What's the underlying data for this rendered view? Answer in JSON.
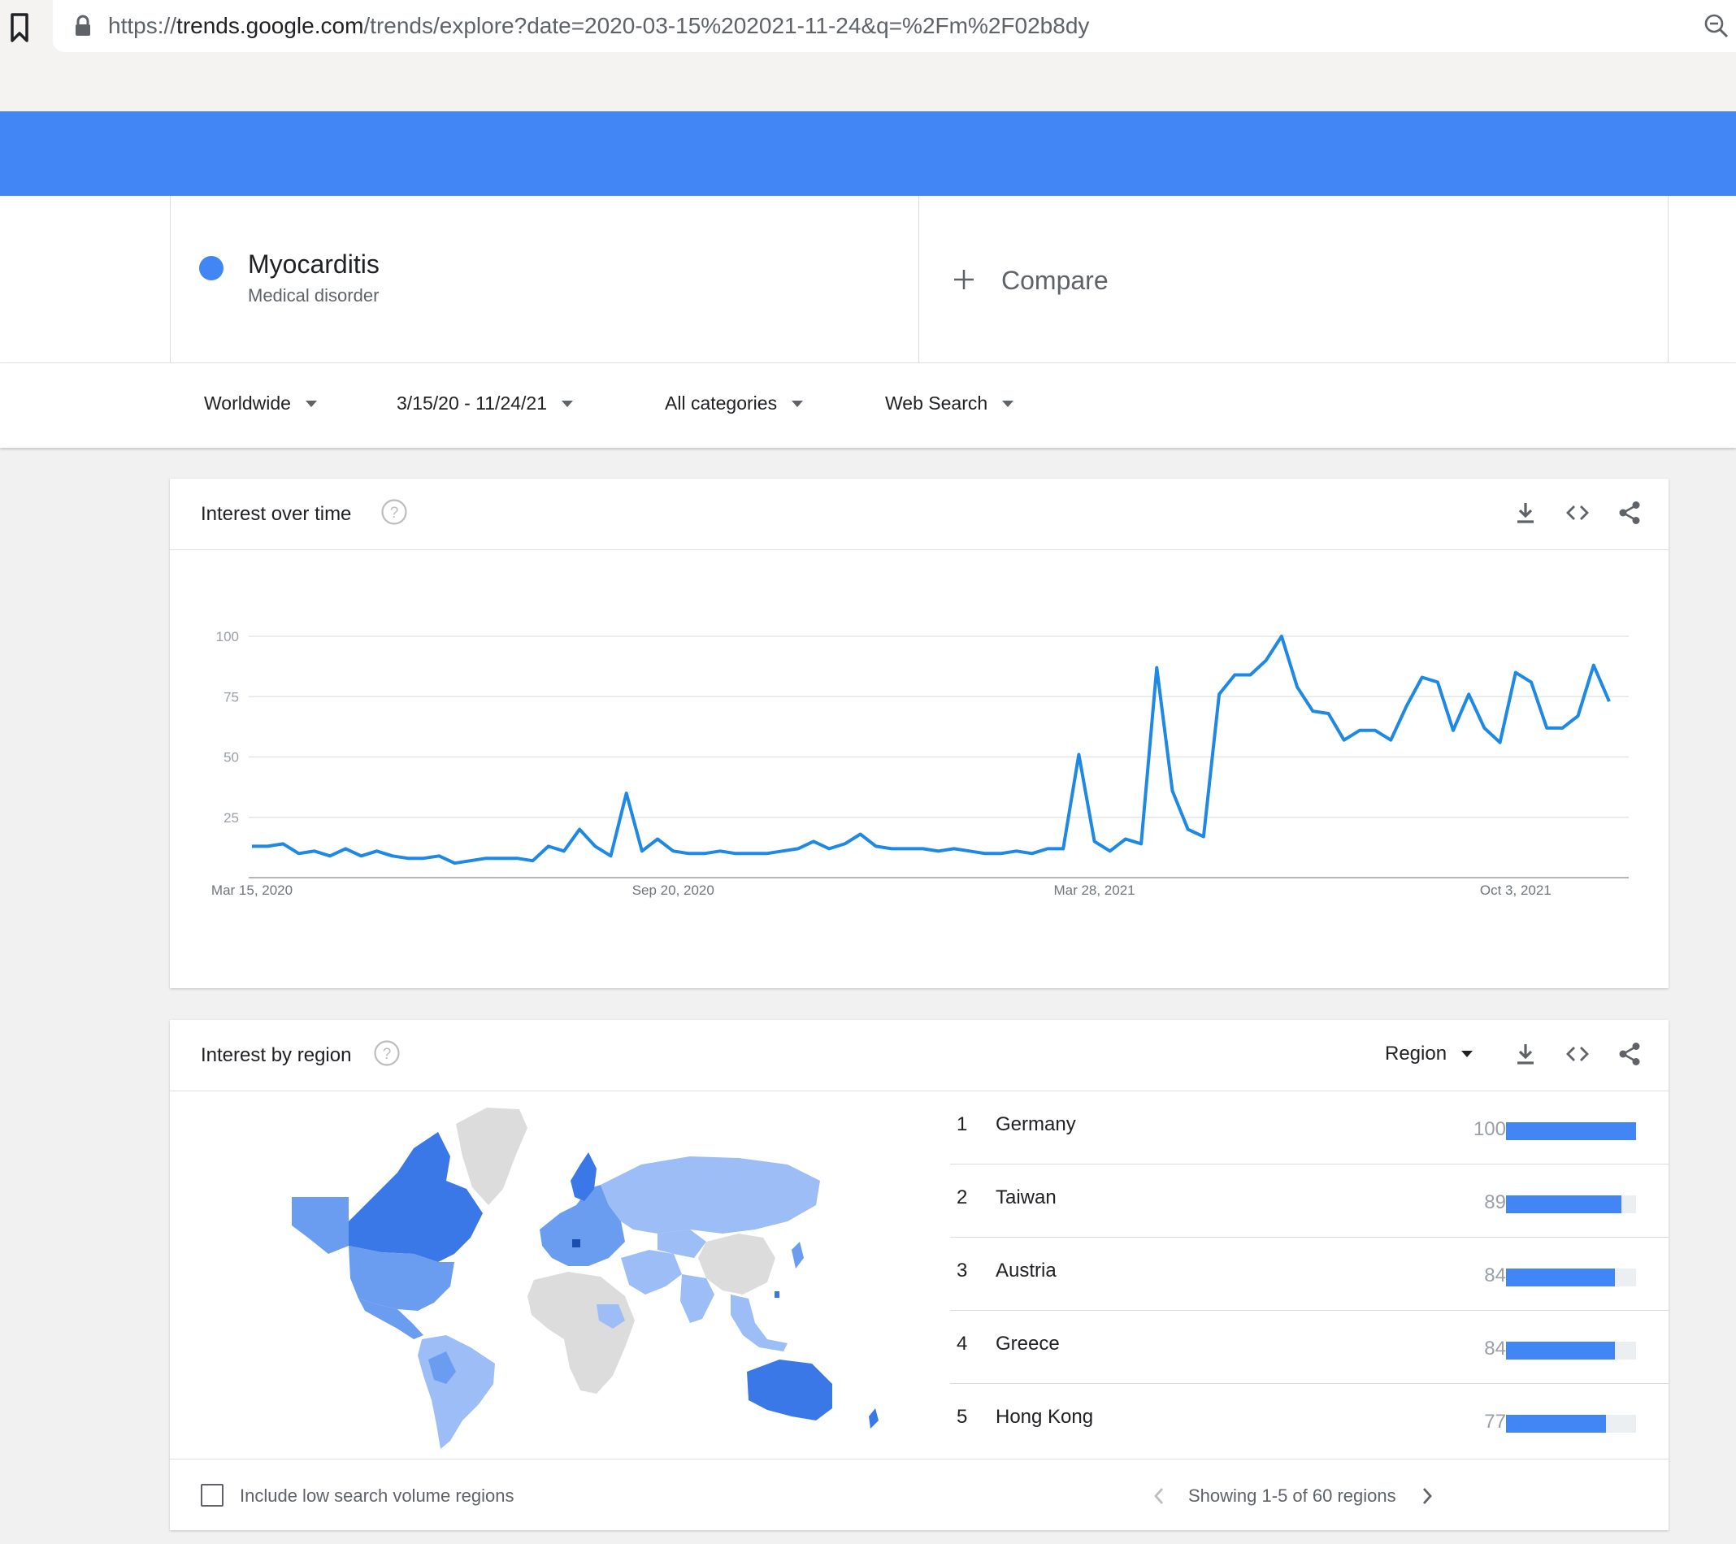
{
  "browser": {
    "url_prefix": "https://",
    "url_host": "trends.google.com",
    "url_path": "/trends/explore?date=2020-03-15%202021-11-24&q=%2Fm%2F02b8dy"
  },
  "search_term": {
    "name": "Myocarditis",
    "type": "Medical disorder",
    "color": "#4285f4"
  },
  "compare": {
    "label": "Compare"
  },
  "filters": {
    "region": "Worldwide",
    "date_range": "3/15/20 - 11/24/21",
    "category": "All categories",
    "search_type": "Web Search"
  },
  "interest_over_time": {
    "title": "Interest over time"
  },
  "chart_data": {
    "type": "line",
    "title": "",
    "xlabel": "",
    "ylabel": "",
    "ylim": [
      0,
      100
    ],
    "y_ticks": [
      "100",
      "75",
      "50",
      "25"
    ],
    "x_ticks": [
      "Mar 15, 2020",
      "Sep 20, 2020",
      "Mar 28, 2021",
      "Oct 3, 2021"
    ],
    "grid": true,
    "series": [
      {
        "color": "#1e88e5",
        "values": [
          13,
          13,
          14,
          10,
          11,
          9,
          12,
          9,
          11,
          9,
          8,
          8,
          9,
          6,
          7,
          8,
          8,
          8,
          7,
          13,
          11,
          20,
          13,
          9,
          35,
          11,
          16,
          11,
          10,
          10,
          11,
          10,
          10,
          10,
          11,
          12,
          15,
          12,
          14,
          18,
          13,
          12,
          12,
          12,
          11,
          12,
          11,
          10,
          10,
          11,
          10,
          12,
          12,
          51,
          15,
          11,
          16,
          14,
          87,
          36,
          20,
          17,
          76,
          84,
          84,
          90,
          100,
          79,
          69,
          68,
          57,
          61,
          61,
          57,
          71,
          83,
          81,
          61,
          76,
          62,
          56,
          85,
          81,
          62,
          62,
          67,
          88,
          73
        ]
      }
    ]
  },
  "interest_by_region": {
    "title": "Interest by region",
    "resolution": "Region",
    "rows": [
      {
        "rank": "1",
        "name": "Germany",
        "value": "100",
        "pct": 100
      },
      {
        "rank": "2",
        "name": "Taiwan",
        "value": "89",
        "pct": 89
      },
      {
        "rank": "3",
        "name": "Austria",
        "value": "84",
        "pct": 84
      },
      {
        "rank": "4",
        "name": "Greece",
        "value": "84",
        "pct": 84
      },
      {
        "rank": "5",
        "name": "Hong Kong",
        "value": "77",
        "pct": 77
      }
    ],
    "include_low_label": "Include low search volume regions",
    "pagination": "Showing 1-5 of 60 regions"
  },
  "colors": {
    "brand_blue": "#4285f4",
    "line_blue": "#1e88e5",
    "map_dark": "#3b78e7",
    "map_mid": "#6a9cf0",
    "map_light": "#9cbdf6",
    "map_none": "#dcdcdc"
  }
}
